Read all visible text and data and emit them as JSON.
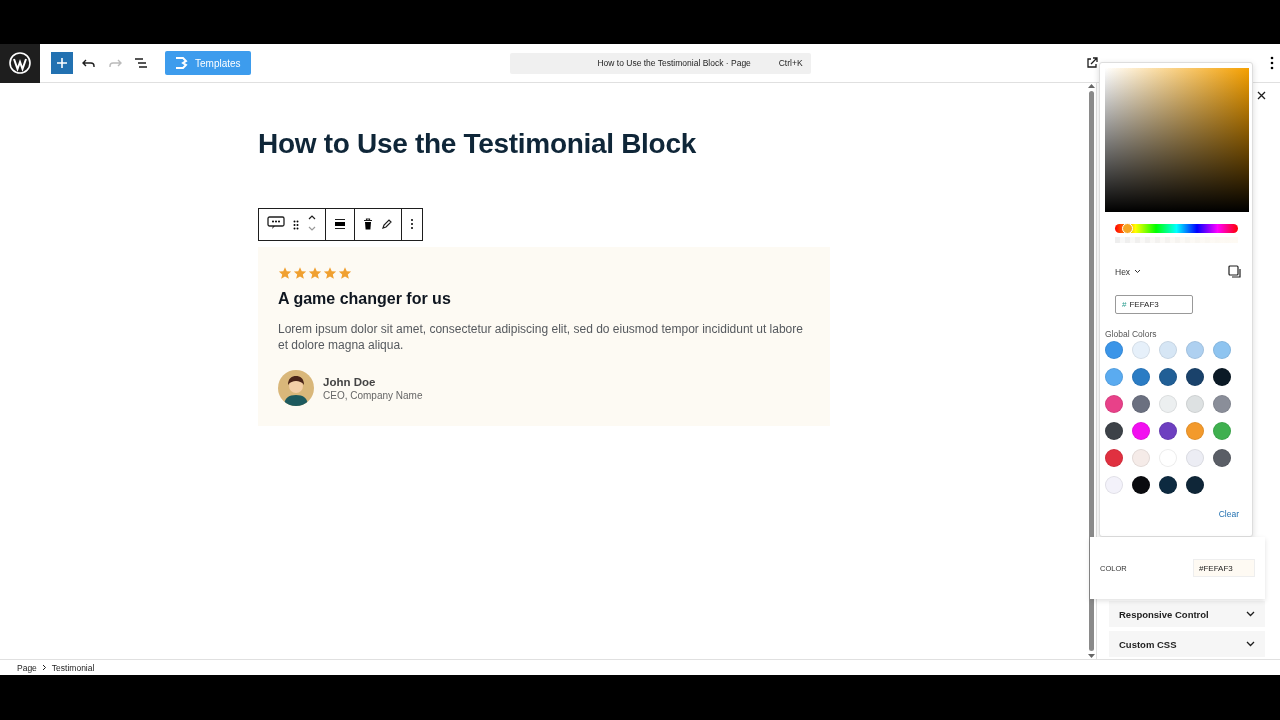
{
  "topbar": {
    "templates_button": "Templates",
    "command": {
      "title": "How to Use the Testimonial Block · Page",
      "shortcut": "Ctrl+K"
    }
  },
  "page_title": "How to Use the Testimonial Block",
  "testimonial": {
    "stars": 5,
    "heading": "A game changer for us",
    "text": "Lorem ipsum dolor sit amet, consectetur adipiscing elit, sed do eiusmod tempor incididunt ut labore et dolore magna aliqua.",
    "name": "John Doe",
    "role": "CEO, Company Name"
  },
  "color_picker": {
    "hue_slider": {
      "level": 0.1
    },
    "alpha_slider": {
      "level": 1
    },
    "format": "Hex",
    "hex_prefix": "#",
    "hex_value": "FEFAF3",
    "global_colors_label": "Global Colors",
    "swatches": [
      {
        "color": "#3b95e8"
      },
      {
        "color": "#e6f0fa"
      },
      {
        "color": "#d6e6f5"
      },
      {
        "color": "#aed0f0"
      },
      {
        "color": "#8ec4f0"
      },
      {
        "color": "#5aabf0"
      },
      {
        "color": "#2b7cc4"
      },
      {
        "color": "#215f96"
      },
      {
        "color": "#1a426b"
      },
      {
        "color": "#0b1a26"
      },
      {
        "color": "#e84189"
      },
      {
        "color": "#6b7080"
      },
      {
        "color": "#eceff0"
      },
      {
        "color": "#dde1e2"
      },
      {
        "color": "#8a8e99"
      },
      {
        "color": "#3d4248"
      },
      {
        "color": "#f20ff0"
      },
      {
        "color": "#6d3fc0"
      },
      {
        "color": "#f39a2c"
      },
      {
        "color": "#3fb04f"
      },
      {
        "color": "#e03040"
      },
      {
        "color": "#f5ebe8"
      },
      {
        "color": "#ffffff"
      },
      {
        "color": "#ecedf4"
      },
      {
        "color": "#5a5e66"
      },
      {
        "color": "#f3f2fa"
      },
      {
        "color": "#0a0b0f"
      },
      {
        "color": "#0d2a40"
      },
      {
        "color": "#0f2638"
      }
    ],
    "clear": "Clear"
  },
  "color_setting": {
    "label": "COLOR",
    "value": "#FEFAF3"
  },
  "sidebar": {
    "panels": [
      {
        "label": "Responsive Control",
        "expanded": false
      },
      {
        "label": "Custom CSS",
        "expanded": false
      }
    ]
  },
  "breadcrumbs": [
    "Page",
    "Testimonial"
  ]
}
